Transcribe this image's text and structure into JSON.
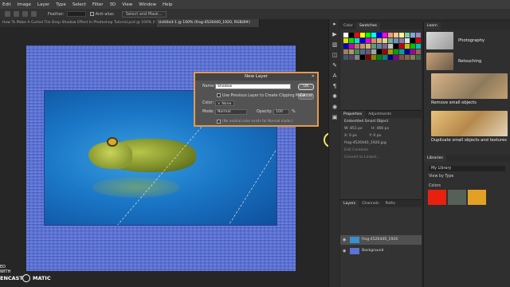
{
  "menu": [
    "Edit",
    "Image",
    "Layer",
    "Type",
    "Select",
    "Filter",
    "3D",
    "View",
    "Window",
    "Help"
  ],
  "options_bar": {
    "feather_label": "Feather:",
    "feather_value": "",
    "anti_alias": "Anti-alias",
    "select_mask": "Select and Mask..."
  },
  "doc_tabs": [
    {
      "label": "How To Make A Curled Tile Drop Shadow Effect In Photoshop Tutorial.psd @ 100% (Shadow, RGB/8#)"
    },
    {
      "label": "Untitled-1 @ 100% (frog-4526440_1920, RGB/8#)"
    }
  ],
  "dialog": {
    "title": "New Layer",
    "name_label": "Name:",
    "name_value": "Shadow",
    "ok_label": "OK",
    "cancel_label": "Cancel",
    "clip_label": "Use Previous Layer to Create Clipping Mask",
    "color_label": "Color:",
    "color_value": "None",
    "mode_label": "Mode:",
    "mode_value": "Normal",
    "opacity_label": "Opacity:",
    "opacity_value": "100",
    "opacity_unit": "%",
    "neutral_label": "(No neutral color exists for Normal mode.)"
  },
  "color_panel": {
    "tab1": "Color",
    "tab2": "Swatches"
  },
  "props_panel": {
    "tab1": "Properties",
    "tab2": "Adjustments",
    "type": "Embedded Smart Object",
    "w_label": "W:",
    "w_value": "851 px",
    "h_label": "H:",
    "h_value": "466 px",
    "x_label": "X:",
    "x_value": "0 px",
    "y_label": "Y:",
    "y_value": "0 px",
    "file": "frog-4526440_1920.jpg",
    "edit_contents": "Edit Contents",
    "convert_linked": "Convert to Linked..."
  },
  "layers_panel": {
    "tab1": "Layers",
    "tab2": "Channels",
    "tab3": "Paths",
    "layers": [
      {
        "name": "frog-4526440_1920",
        "selected": true
      },
      {
        "name": "Background",
        "selected": false
      }
    ]
  },
  "learn_panel": {
    "tab": "Learn",
    "items": [
      {
        "label": "Photography"
      },
      {
        "label": "Retouching"
      },
      {
        "label": "Remove small objects"
      },
      {
        "label": "Duplicate small objects and textures"
      }
    ],
    "libraries_tab": "Libraries",
    "library_name": "My Library",
    "view_by": "View by Type",
    "colors_heading": "Colors",
    "chips": [
      "#e8210f",
      "#556158",
      "#e2a024"
    ]
  },
  "watermark": {
    "prefix": "ED WITH",
    "brand_left": "ENCAST",
    "brand_right": "MATIC"
  }
}
